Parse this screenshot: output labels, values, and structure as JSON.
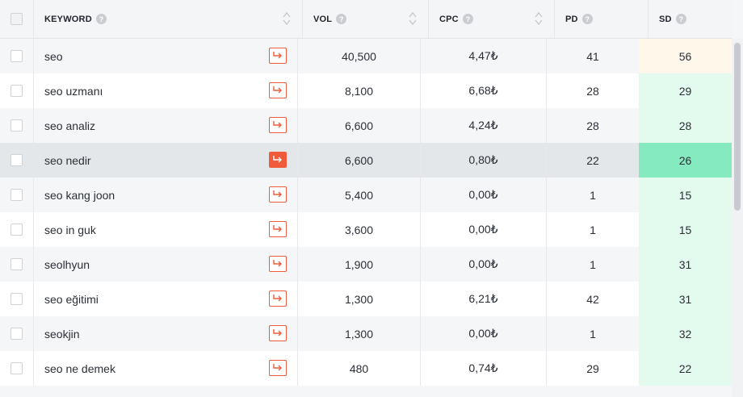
{
  "header": {
    "keyword": "KEYWORD",
    "vol": "VOL",
    "cpc": "CPC",
    "pd": "PD",
    "sd": "SD",
    "help_glyph": "?"
  },
  "rows": [
    {
      "keyword": "seo",
      "vol": "40,500",
      "cpc": "4,47₺",
      "pd": "41",
      "sd": "56"
    },
    {
      "keyword": "seo uzmanı",
      "vol": "8,100",
      "cpc": "6,68₺",
      "pd": "28",
      "sd": "29"
    },
    {
      "keyword": "seo analiz",
      "vol": "6,600",
      "cpc": "4,24₺",
      "pd": "28",
      "sd": "28"
    },
    {
      "keyword": "seo nedir",
      "vol": "6,600",
      "cpc": "0,80₺",
      "pd": "22",
      "sd": "26"
    },
    {
      "keyword": "seo kang joon",
      "vol": "5,400",
      "cpc": "0,00₺",
      "pd": "1",
      "sd": "15"
    },
    {
      "keyword": "seo in guk",
      "vol": "3,600",
      "cpc": "0,00₺",
      "pd": "1",
      "sd": "15"
    },
    {
      "keyword": "seolhyun",
      "vol": "1,900",
      "cpc": "0,00₺",
      "pd": "1",
      "sd": "31"
    },
    {
      "keyword": "seo eğitimi",
      "vol": "1,300",
      "cpc": "6,21₺",
      "pd": "42",
      "sd": "31"
    },
    {
      "keyword": "seokjin",
      "vol": "1,300",
      "cpc": "0,00₺",
      "pd": "1",
      "sd": "32"
    },
    {
      "keyword": "seo ne demek",
      "vol": "480",
      "cpc": "0,74₺",
      "pd": "29",
      "sd": "22"
    }
  ],
  "colors": {
    "accent": "#ef5b3b",
    "sd_easy": "#e3fbef",
    "sd_medium": "#fef8ea",
    "sd_highlight": "#86eac0",
    "row_hover": "#e4e7ea"
  },
  "icons": {
    "sort": "sort-arrows-icon",
    "help": "help-circle-icon",
    "open": "arrow-go-icon"
  }
}
